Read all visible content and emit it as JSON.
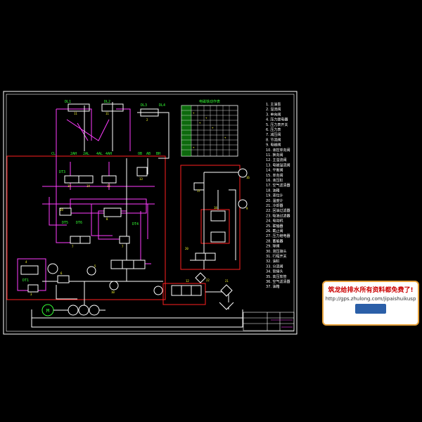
{
  "labels": {
    "top_left_a": "DL1",
    "top_left_b": "DL2",
    "top_right_a": "DL3",
    "top_right_b": "DL4",
    "port_a": "CL",
    "port_b": "2AH",
    "port_c": "2AL",
    "port_d": "4AL",
    "port_e": "4AH",
    "port_f": "OB",
    "port_g": "AB",
    "port_h": "BH",
    "dt3": "DT3",
    "dt5": "DT5",
    "dt6": "DT6",
    "dt4": "DT4",
    "dt1": "DT1",
    "m_label": "M"
  },
  "table_title": "电磁铁动作表",
  "legend_items": [
    "1. 主油泵",
    "2. 溢流阀",
    "3. 单向阀",
    "4. 压力继电器",
    "5. 压力表开关",
    "6. 压力表",
    "7. 减压阀",
    "8. 节流阀",
    "9. 电磁阀",
    "10. 液控单向阀",
    "11. 换向阀",
    "12. 主溢流阀",
    "13. 电磁溢流阀",
    "14. 平衡阀",
    "15. 单向阀",
    "16. 液压缸",
    "17. 空气滤清器",
    "18. 油箱",
    "19. 液位计",
    "20. 温度计",
    "21. 冷却器",
    "22. 回油过滤器",
    "23. 吸油过滤器",
    "24. 电动机",
    "25. 联轴器",
    "26. 截止阀",
    "27. 压力继电器",
    "28. 蓄能器",
    "29. 球阀",
    "30. 测压接头",
    "31. 行程开关",
    "32. 油缸",
    "33. 分流阀",
    "34. 管接头",
    "35. 高压软管",
    "36. 空气滤清器",
    "37. 油箱"
  ],
  "watermark": {
    "line1": "筑龙给排水所有资料都免费了!",
    "line2": "http://gps.zhulong.com/jipaishuikusp"
  },
  "colors": {
    "frame": "#ffffff",
    "hydraulic": "#ffffff",
    "pilot": "#ff3cff",
    "boundary": "#ff2020",
    "label": "#35ff35",
    "number": "#ffff30",
    "table_grid": "#ffffff",
    "table_fill": "#18c018"
  }
}
